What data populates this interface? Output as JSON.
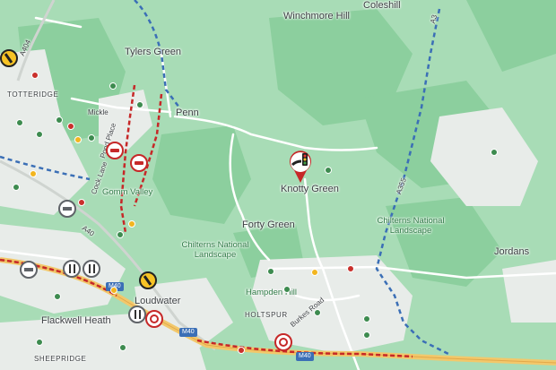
{
  "places": {
    "winchmore_hill": "Winchmore Hill",
    "coleshill": "Coleshill",
    "tylers_green": "Tylers Green",
    "totteridge": "TOTTERIDGE",
    "penn": "Penn",
    "knotty_green": "Knotty Green",
    "forty_green": "Forty Green",
    "chilterns_west": "Chilterns National Landscape",
    "chilterns_east": "Chilterns National Landscape",
    "gomm_valley": "Gomm Valley",
    "jordans": "Jordans",
    "hampden_hill": "Hampden Hill",
    "holtspur": "HOLTSPUR",
    "loudwater": "Loudwater",
    "flackwell_heath": "Flackwell Heath",
    "sheepridge": "SHEEPRIDGE",
    "micklefield": "Mickle"
  },
  "roads": {
    "a404": "A404",
    "a40": "A40",
    "a355": "A355",
    "a3": "A3",
    "m40_a": "M40",
    "m40_b": "M40",
    "m40_c": "M40",
    "burkes_road": "Burkes Road",
    "cock_lane": "Cock Lane",
    "pond_place": "Pond Place"
  },
  "colors": {
    "map_green": "#a8dcb6",
    "dark_green": "#8ccf9e",
    "road": "#ffffff",
    "motorway": "#f2c86b",
    "boundary": "#3b6fb6",
    "incident_red": "#c62828"
  },
  "markers": {
    "selected": "traffic-light-pin",
    "closures": [
      "road-closure-icon"
    ],
    "works": [
      "roadworks-icon"
    ],
    "lanes": [
      "lane-closure-icon"
    ]
  }
}
